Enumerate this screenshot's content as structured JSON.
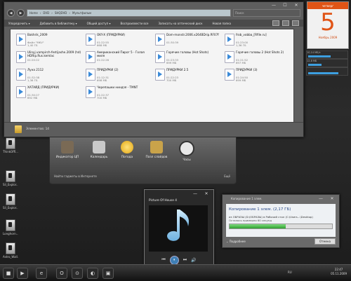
{
  "explorer": {
    "path": [
      "Home",
      "DVD",
      "SHQDVD",
      "Мультфильм"
    ],
    "search_placeholder": "Поиск",
    "toolbar": [
      "Упорядочить ▾",
      "Добавить в библиотеку ▾",
      "Общий доступ ▾",
      "Воспроизвести все",
      "Записать на оптический диск",
      "Новая папка"
    ],
    "files": [
      {
        "name": "Bakhrik_2009",
        "sub1": "Файл \"MKV\"",
        "sub2": "1,40 ГБ"
      },
      {
        "name": "OKY-X (ПРИДУРКИ)",
        "sub1": "01:22:55",
        "sub2": "668 МБ"
      },
      {
        "name": "Dom-monstr.2006.x264BDrip.RF07f",
        "sub1": "01:30:39",
        "sub2": ""
      },
      {
        "name": "frob_vobba_[Rfile.ru]",
        "sub1": "01:23:00",
        "sub2": "1,36 ГБ"
      },
      {
        "name": "Ulinyj.vampirch-festijashe.2009 (hd) HDRip.Rus.kemlac",
        "sub1": "01:20:22",
        "sub2": ""
      },
      {
        "name": "Американский Пирог 5 - Голая миля",
        "sub1": "01:22:26",
        "sub2": ""
      },
      {
        "name": "Горячие головы (Hot Shots)",
        "sub1": "01:23:33",
        "sub2": "699 МБ"
      },
      {
        "name": "Горячие головы 2 (Hot Shots 2)",
        "sub1": "01:21:52",
        "sub2": "697 МБ"
      },
      {
        "name": "Луна 2112",
        "sub1": "01:32:38",
        "sub2": "1,36 ГБ"
      },
      {
        "name": "ПРИДУРКИ (2)",
        "sub1": "01:12:31",
        "sub2": "698 МБ"
      },
      {
        "name": "ПРИДУРКИ 2.5",
        "sub1": "01:22:23",
        "sub2": "700 МБ"
      },
      {
        "name": "ПРИДУРКИ (3)",
        "sub1": "01:24:50",
        "sub2": "699 МБ"
      },
      {
        "name": "ХАТАЙД (ПРИДУРКИ)",
        "sub1": "01:30:27",
        "sub2": "692 МБ"
      },
      {
        "name": "Черепашки ниндзя - TMNT",
        "sub1": "01:22:37",
        "sub2": "700 МБ"
      }
    ],
    "status": "Элементов: 14"
  },
  "dock": {
    "items": [
      {
        "label": "Индикатор ЦП",
        "color": "#7a6a55"
      },
      {
        "label": "Календарь",
        "color": "#c9c9c9"
      },
      {
        "label": "Погода",
        "color": "#f2c02c"
      },
      {
        "label": "Пазл слайдов",
        "color": "#c9a34a"
      },
      {
        "label": "Часы",
        "color": "#e8e8e8"
      }
    ],
    "footer_left": "Найти гаджеты в Интернете",
    "footer_right": "Ещё"
  },
  "player": {
    "title": "Picture Of House 4",
    "controls": [
      "⏮",
      "⏸",
      "⏭",
      "🔊"
    ]
  },
  "copy": {
    "title": "Копирование 1 элем.",
    "heading": "Копирование 1 элем. (2,17 ГБ)",
    "from_to": "из ОБРАЗЫ (D:\\ОБРАЗЫ) в Рабочий стол (C:\\Users...\\Desktop)",
    "remaining": "Осталось примерно 60 секунд",
    "details": "Подробнее",
    "cancel": "Отмена",
    "progress_percent": 55
  },
  "calendar": {
    "weekday": "четверг",
    "day": "5",
    "month_year": "Ноябрь 2009"
  },
  "meters": [
    {
      "label": "10,14 МБ/с",
      "fill": 0.6
    },
    {
      "label": "12,8 МБ",
      "fill": 0.35
    },
    {
      "label": "",
      "fill": 0.8
    }
  ],
  "desktop_icons": [
    "ThinkOffl...",
    "Sil_Explor...",
    "Sil_Explor...",
    "Longhorn...",
    "Astro_Wall..."
  ],
  "taskbar": {
    "buttons": [
      "■",
      "▶",
      "e",
      "O",
      "⊙",
      "◐",
      "▣"
    ],
    "time": "22:47",
    "date": "05.11.2009",
    "lang": "RU"
  }
}
